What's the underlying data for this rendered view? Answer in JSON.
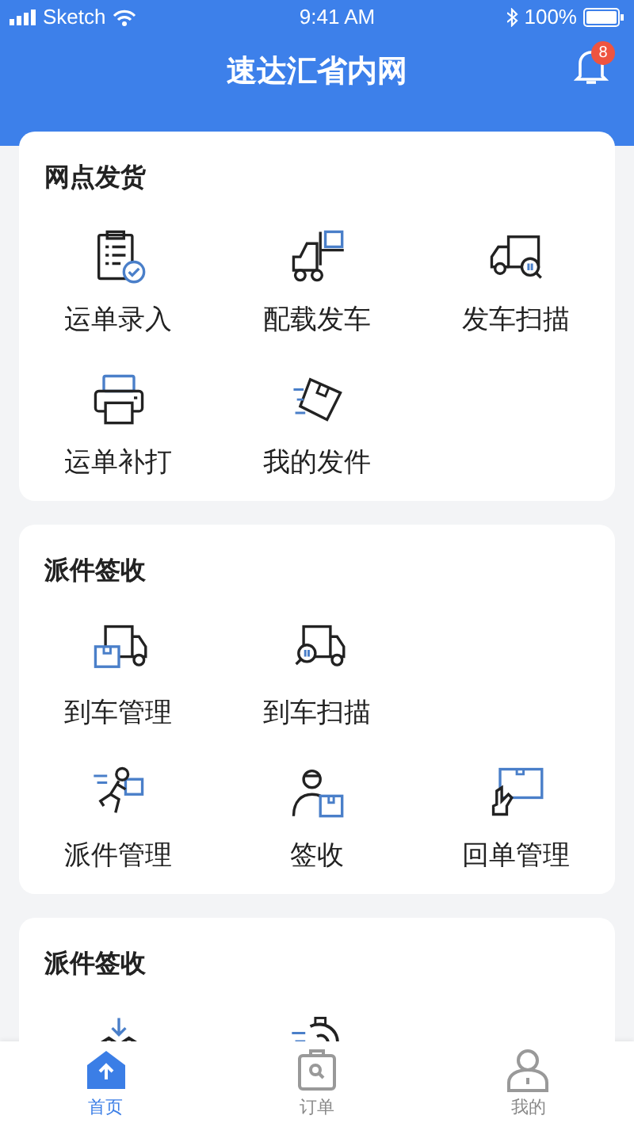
{
  "status_bar": {
    "carrier": "Sketch",
    "time": "9:41 AM",
    "battery": "100%"
  },
  "header": {
    "title": "速达汇省内网",
    "notification_count": "8"
  },
  "sections": [
    {
      "title": "网点发货",
      "items": [
        {
          "kind": "tile",
          "label": "运单录入"
        },
        {
          "kind": "tile",
          "label": "配载发车"
        },
        {
          "kind": "tile",
          "label": "发车扫描"
        },
        {
          "kind": "tile",
          "label": "运单补打"
        },
        {
          "kind": "tile",
          "label": "我的发件"
        }
      ]
    },
    {
      "title": "派件签收",
      "items": [
        {
          "kind": "tile",
          "label": "到车管理"
        },
        {
          "kind": "tile",
          "label": "到车扫描"
        },
        {
          "kind": "gap"
        },
        {
          "kind": "tile",
          "label": "派件管理"
        },
        {
          "kind": "tile",
          "label": "签收"
        },
        {
          "kind": "tile",
          "label": "回单管理"
        }
      ]
    },
    {
      "title": "派件签收",
      "items": [
        {
          "kind": "icon"
        },
        {
          "kind": "icon"
        }
      ]
    }
  ],
  "tab_bar": [
    {
      "label": "首页",
      "selected": true
    },
    {
      "label": "订单",
      "selected": false
    },
    {
      "label": "我的",
      "selected": false
    }
  ]
}
